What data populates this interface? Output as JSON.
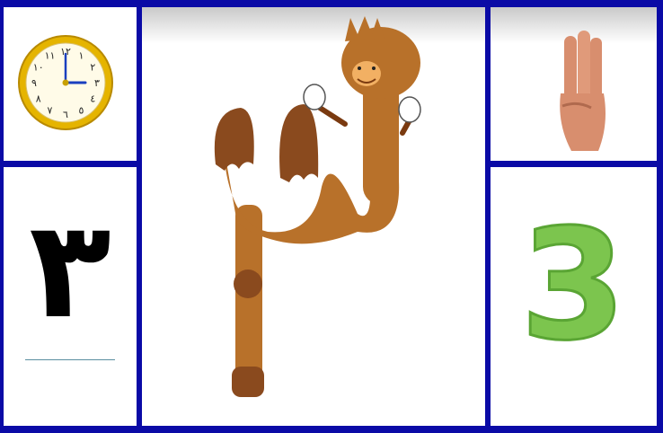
{
  "clock": {
    "numerals": [
      "١٢",
      "١",
      "٢",
      "٣",
      "٤",
      "٥",
      "٦",
      "٧",
      "٨",
      "٩",
      "١٠",
      "١١"
    ],
    "time_hour": 3,
    "time_minute": 0,
    "colors": {
      "frame": "#e5b400",
      "hand": "#1a3fbf"
    }
  },
  "arabic_digit": "٣",
  "latin_digit": "3",
  "colors": {
    "border": "#0a0aa6",
    "camel": "#b8712a",
    "numeral_green": "#7cc54e"
  }
}
